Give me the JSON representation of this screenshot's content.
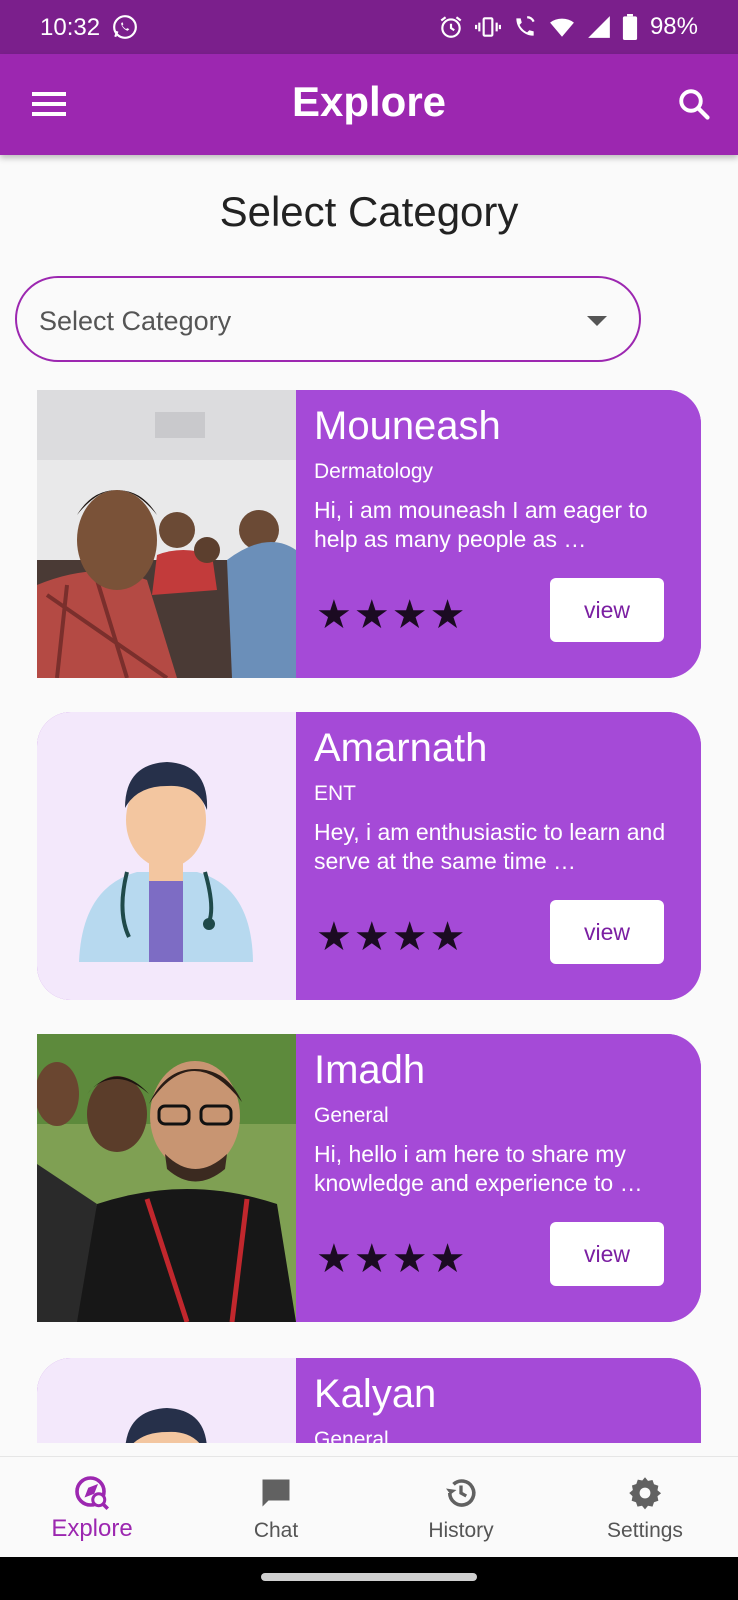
{
  "status_bar": {
    "time": "10:32",
    "battery": "98%",
    "icons": [
      "whatsapp-icon",
      "alarm-icon",
      "vibrate-icon",
      "wifi-call-icon",
      "wifi-icon",
      "signal-icon",
      "battery-icon"
    ]
  },
  "app_bar": {
    "title": "Explore",
    "menu_icon": "menu-icon",
    "search_icon": "search-icon"
  },
  "heading": "Select Category",
  "category_select": {
    "placeholder": "Select Category"
  },
  "colors": {
    "primary": "#9c27b0",
    "status_bar": "#7b1f8c",
    "card": "#a54ad7"
  },
  "doctors": [
    {
      "name": "Mouneash",
      "specialty": "Dermatology",
      "bio": "Hi, i am mouneash I am eager to help as many people as …",
      "rating": "★★★★",
      "button": "view"
    },
    {
      "name": "Amarnath",
      "specialty": "ENT",
      "bio": "Hey, i am enthusiastic to learn and serve at the same time …",
      "rating": "★★★★",
      "button": "view"
    },
    {
      "name": "Imadh",
      "specialty": "General",
      "bio": "Hi, hello i am here to share my knowledge and experience to …",
      "rating": "★★★★",
      "button": "view"
    },
    {
      "name": "Kalyan",
      "specialty": "General"
    }
  ],
  "bottom_nav": {
    "items": [
      {
        "label": "Explore",
        "icon": "explore-icon",
        "active": true
      },
      {
        "label": "Chat",
        "icon": "chat-icon",
        "active": false
      },
      {
        "label": "History",
        "icon": "history-icon",
        "active": false
      },
      {
        "label": "Settings",
        "icon": "settings-icon",
        "active": false
      }
    ]
  }
}
